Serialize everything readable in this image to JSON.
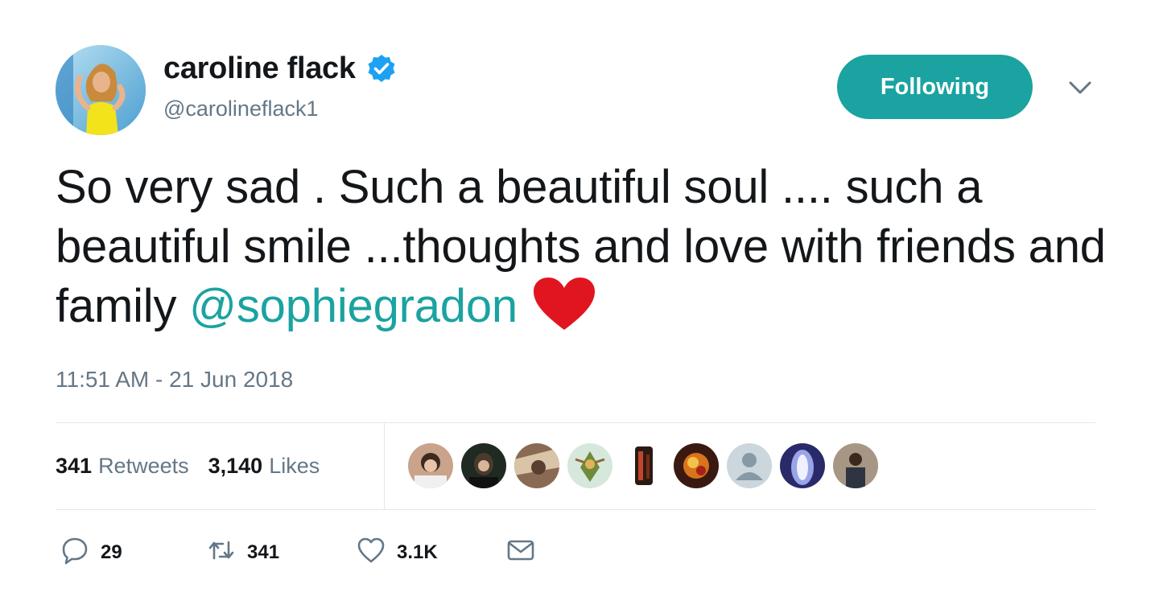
{
  "user": {
    "display_name": "caroline flack",
    "handle": "@carolineflack1",
    "verified": true
  },
  "follow_button": {
    "label": "Following",
    "color": "#1aa3a0"
  },
  "tweet": {
    "text_1": "So very sad . Such a beautiful soul .... such a beautiful smile ...thoughts and love with friends and family ",
    "mention": "@sophiegradon",
    "emoji": "red-heart",
    "timestamp": "11:51 AM - 21 Jun 2018"
  },
  "stats": {
    "retweets_count": "341",
    "retweets_label": "Retweets",
    "likes_count": "3,140",
    "likes_label": "Likes"
  },
  "actions": {
    "reply_count": "29",
    "retweet_count": "341",
    "like_count": "3.1K"
  },
  "colors": {
    "accent": "#1aa3a0",
    "muted": "#657786",
    "text": "#14171a",
    "heart": "#e0151f"
  }
}
